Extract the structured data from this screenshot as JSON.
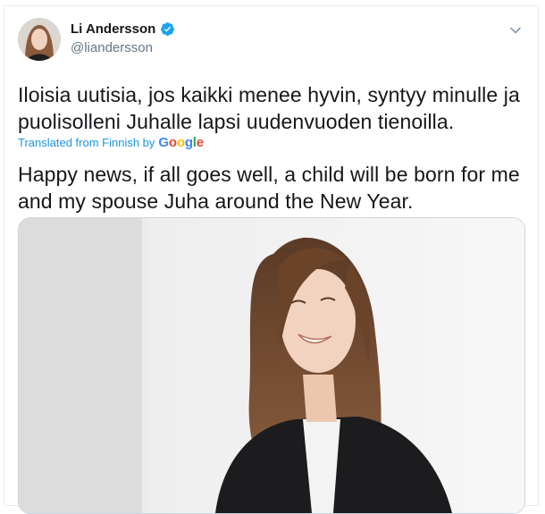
{
  "user": {
    "name": "Li Andersson",
    "handle": "@liandersson",
    "verified": true
  },
  "tweet": {
    "text_original_line1": "Iloisia uutisia, jos kaikki menee hyvin, syntyy minulle ja",
    "text_original_line2": "puolisolleni Juhalle lapsi uudenvuoden tienoilla.",
    "translation_label": "Translated from Finnish by",
    "translation_provider": "Google",
    "text_translated_line1": "Happy news, if all goes well, a child will be born for me",
    "text_translated_line2": "and my spouse Juha around the New Year."
  },
  "icons": {
    "menu": "chevron-down-icon",
    "verified": "verified-badge-icon"
  },
  "colors": {
    "link": "#1b95e0",
    "verified": "#1da1f2",
    "handle": "#657786",
    "text": "#14171a",
    "border": "#e6ecf0"
  }
}
